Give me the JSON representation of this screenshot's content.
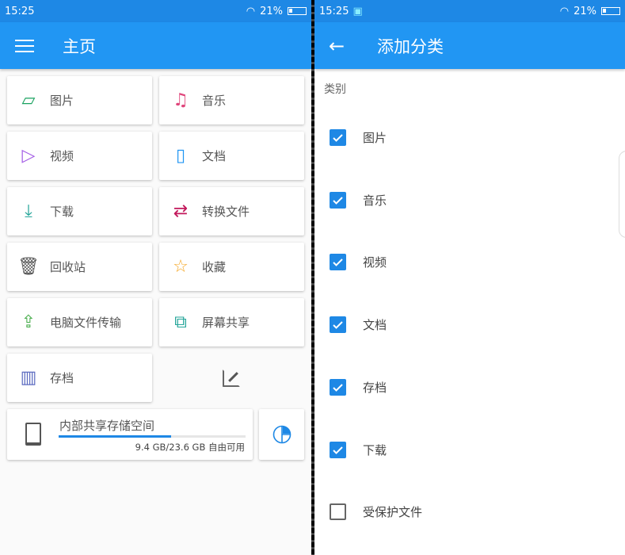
{
  "status": {
    "time": "15:25",
    "battery": "21%"
  },
  "left": {
    "title": "主页",
    "tiles": [
      {
        "label": "图片",
        "icon": "image-icon",
        "color": "#1aa260"
      },
      {
        "label": "音乐",
        "icon": "music-icon",
        "color": "#e0457b"
      },
      {
        "label": "视频",
        "icon": "play-icon",
        "color": "#a45ee5"
      },
      {
        "label": "文档",
        "icon": "document-icon",
        "color": "#2196f3"
      },
      {
        "label": "下载",
        "icon": "download-icon",
        "color": "#26a69a"
      },
      {
        "label": "转换文件",
        "icon": "transfer-icon",
        "color": "#c2185b"
      },
      {
        "label": "回收站",
        "icon": "trash-icon",
        "color": "#555555"
      },
      {
        "label": "收藏",
        "icon": "star-icon",
        "color": "#f5a623"
      },
      {
        "label": "电脑文件传输",
        "icon": "pc-transfer-icon",
        "color": "#4caf50"
      },
      {
        "label": "屏幕共享",
        "icon": "screen-share-icon",
        "color": "#26a69a"
      },
      {
        "label": "存档",
        "icon": "archive-icon",
        "color": "#5c6bc0"
      }
    ],
    "storage": {
      "name": "内部共享存储空间",
      "size": "9.4 GB/23.6 GB 自由可用",
      "used_fraction": 0.6
    }
  },
  "right": {
    "title": "添加分类",
    "section": "类别",
    "items": [
      {
        "label": "图片",
        "checked": true
      },
      {
        "label": "音乐",
        "checked": true
      },
      {
        "label": "视频",
        "checked": true
      },
      {
        "label": "文档",
        "checked": true
      },
      {
        "label": "存档",
        "checked": true
      },
      {
        "label": "下载",
        "checked": true
      },
      {
        "label": "受保护文件",
        "checked": false
      }
    ]
  }
}
